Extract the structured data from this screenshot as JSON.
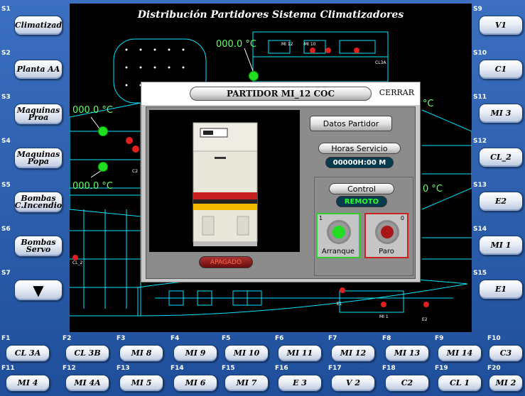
{
  "left_panel": [
    {
      "slot": "S1",
      "label": "Climatizad"
    },
    {
      "slot": "S2",
      "label": "Planta AA"
    },
    {
      "slot": "S3",
      "label": "Maquinas Proa"
    },
    {
      "slot": "S4",
      "label": "Maquinas Popa"
    },
    {
      "slot": "S5",
      "label": "Bombas C.Incendio"
    },
    {
      "slot": "S6",
      "label": "Bombas Servo"
    },
    {
      "slot": "S7",
      "label": "▼"
    }
  ],
  "right_panel": [
    {
      "slot": "S9",
      "label": "V1"
    },
    {
      "slot": "S10",
      "label": "C1"
    },
    {
      "slot": "S11",
      "label": "MI 3"
    },
    {
      "slot": "S12",
      "label": "CL_2"
    },
    {
      "slot": "S13",
      "label": "E2"
    },
    {
      "slot": "S14",
      "label": "MI 1"
    },
    {
      "slot": "S15",
      "label": "E1"
    }
  ],
  "bottom_row1": [
    {
      "slot": "F1",
      "label": "CL 3A"
    },
    {
      "slot": "F2",
      "label": "CL 3B"
    },
    {
      "slot": "F3",
      "label": "MI 8"
    },
    {
      "slot": "F4",
      "label": "MI 9"
    },
    {
      "slot": "F5",
      "label": "MI 10"
    },
    {
      "slot": "F6",
      "label": "MI 11"
    },
    {
      "slot": "F7",
      "label": "MI 12"
    },
    {
      "slot": "F8",
      "label": "MI 13"
    },
    {
      "slot": "F9",
      "label": "MI 14"
    },
    {
      "slot": "F10",
      "label": "C3"
    }
  ],
  "bottom_row2": [
    {
      "slot": "F11",
      "label": "MI 4"
    },
    {
      "slot": "F12",
      "label": "MI 4A"
    },
    {
      "slot": "F13",
      "label": "MI 5"
    },
    {
      "slot": "F14",
      "label": "MI 6"
    },
    {
      "slot": "F15",
      "label": "MI 7"
    },
    {
      "slot": "F16",
      "label": "E 3"
    },
    {
      "slot": "F17",
      "label": "V 2"
    },
    {
      "slot": "F18",
      "label": "C2"
    },
    {
      "slot": "F19",
      "label": "CL 1"
    },
    {
      "slot": "F20",
      "label": "MI 2"
    }
  ],
  "map": {
    "title": "Distribución Partidores Sistema Climatizadores",
    "temps": [
      "000.0 °C",
      "000.0 °C",
      "000.0 °C",
      "°C",
      "0 °C"
    ],
    "labels": [
      "MI 12",
      "MI 10",
      "CL3A",
      "CL_2",
      "MI 1",
      "E2",
      "E1",
      "C2"
    ]
  },
  "popup": {
    "title": "PARTIDOR MI_12 COC",
    "close_label": "CERRAR",
    "state_label": "APAGADO",
    "datos_label": "Datos Partidor",
    "horas_label": "Horas Servicio",
    "horas_value": "00000H:00 M",
    "control_label": "Control",
    "control_mode": "REMOTO",
    "start_label": "Arranque",
    "start_num": "1",
    "stop_label": "Paro",
    "stop_num": "0"
  },
  "colors": {
    "temp_green": "#66ff66",
    "lamp_green": "#22dd22",
    "lamp_red": "#a81616",
    "schematic": "#00e5ff"
  }
}
